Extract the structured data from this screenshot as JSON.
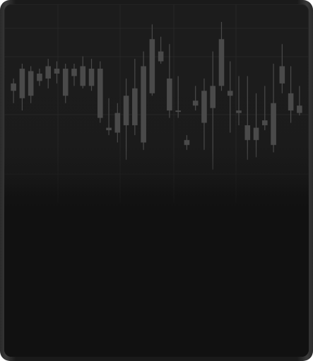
{
  "colors": {
    "background": "#1c1c1c",
    "candle": "#4a4a4a",
    "wick": "#4a4a4a",
    "grid": "#262626"
  },
  "chart_data": {
    "type": "candlestick",
    "grid": true,
    "candles": [
      {
        "o": 107,
        "h": 105,
        "l": 115,
        "c": 110
      },
      {
        "o": 113,
        "h": 99,
        "l": 118,
        "c": 101
      },
      {
        "o": 102,
        "h": 100,
        "l": 115,
        "c": 112
      },
      {
        "o": 106,
        "h": 101,
        "l": 108,
        "c": 103
      },
      {
        "o": 105,
        "h": 97,
        "l": 109,
        "c": 100
      },
      {
        "o": 103,
        "h": 98,
        "l": 107,
        "c": 101
      },
      {
        "o": 101,
        "h": 99,
        "l": 115,
        "c": 112
      },
      {
        "o": 104,
        "h": 99,
        "l": 108,
        "c": 101
      },
      {
        "o": 108,
        "h": 96,
        "l": 109,
        "c": 100
      },
      {
        "o": 101,
        "h": 97,
        "l": 110,
        "c": 108
      },
      {
        "o": 101,
        "h": 98,
        "l": 123,
        "c": 121
      },
      {
        "o": 126,
        "h": 113,
        "l": 128,
        "c": 125
      },
      {
        "o": 127,
        "h": 115,
        "l": 131,
        "c": 119
      },
      {
        "o": 112,
        "h": 105,
        "l": 138,
        "c": 124
      },
      {
        "o": 109,
        "h": 97,
        "l": 128,
        "c": 124
      },
      {
        "o": 131,
        "h": 94,
        "l": 134,
        "c": 100
      },
      {
        "o": 111,
        "h": 83,
        "l": 112,
        "c": 89
      },
      {
        "o": 98,
        "h": 88,
        "l": 99,
        "c": 94
      },
      {
        "o": 105,
        "h": 91,
        "l": 121,
        "c": 118
      },
      {
        "o": 118,
        "h": 104,
        "l": 121,
        "c": 118
      },
      {
        "o": 132,
        "h": 128,
        "l": 134,
        "c": 130
      },
      {
        "o": 116,
        "h": 108,
        "l": 118,
        "c": 114
      },
      {
        "o": 123,
        "h": 105,
        "l": 134,
        "c": 110
      },
      {
        "o": 117,
        "h": 94,
        "l": 142,
        "c": 108
      },
      {
        "o": 108,
        "h": 82,
        "l": 110,
        "c": 89
      },
      {
        "o": 110,
        "h": 98,
        "l": 127,
        "c": 112
      },
      {
        "o": 118,
        "h": 104,
        "l": 124,
        "c": 119
      },
      {
        "o": 130,
        "h": 104,
        "l": 138,
        "c": 124
      },
      {
        "o": 130,
        "h": 111,
        "l": 137,
        "c": 125
      },
      {
        "o": 122,
        "h": 108,
        "l": 126,
        "c": 124
      },
      {
        "o": 115,
        "h": 99,
        "l": 135,
        "c": 132
      },
      {
        "o": 107,
        "h": 91,
        "l": 111,
        "c": 100
      },
      {
        "o": 118,
        "h": 100,
        "l": 123,
        "c": 111
      },
      {
        "o": 119,
        "h": 108,
        "l": 120,
        "c": 116
      }
    ]
  }
}
